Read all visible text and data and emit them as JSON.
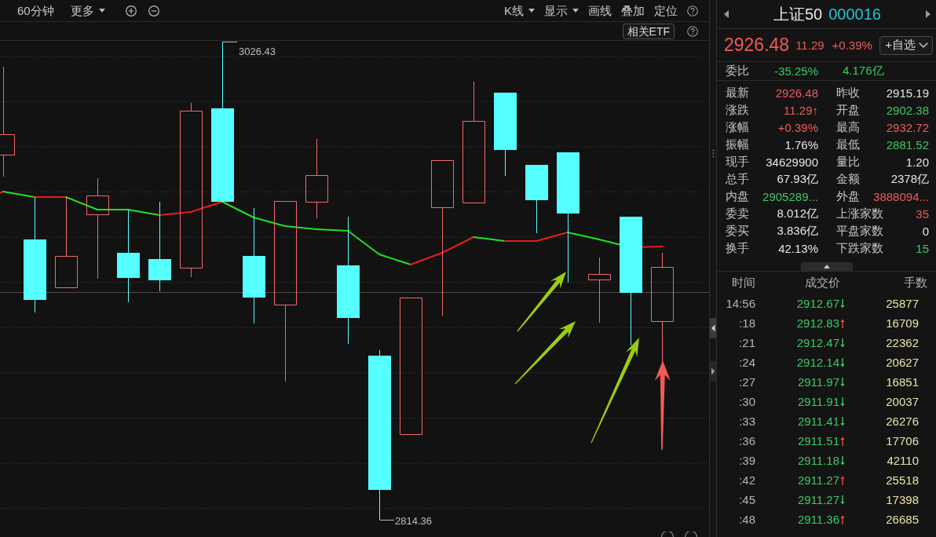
{
  "toolbar": {
    "left_items": [
      {
        "label": "60分钟",
        "dropdown": false
      },
      {
        "label": "更多",
        "dropdown": true
      }
    ],
    "right_items": [
      {
        "label": "K线",
        "dropdown": true
      },
      {
        "label": "显示",
        "dropdown": true
      },
      {
        "label": "画线",
        "dropdown": false
      },
      {
        "label": "叠加",
        "dropdown": false
      },
      {
        "label": "定位",
        "dropdown": false
      }
    ],
    "etf_button": "相关ETF"
  },
  "chart": {
    "high_label": "3026.43",
    "low_label": "2814.36"
  },
  "quote": {
    "name": "上证50",
    "code": "000016",
    "rising": true,
    "price": "2926.48",
    "change": "11.29",
    "change_pct": "+0.39%",
    "watch_button": "+自选",
    "order_ratio": {
      "label": "委比",
      "values": [
        {
          "text": "-35.25%",
          "color": "#3cc864"
        },
        {
          "text": "4.176亿",
          "color": "#3cc864"
        }
      ]
    },
    "fields": [
      {
        "label": "最新",
        "value": "2926.48",
        "color": "#f05a5a"
      },
      {
        "label": "昨收",
        "value": "2915.19",
        "color": "#e6e6e6"
      },
      {
        "label": "涨跌",
        "value": "11.29↑",
        "color": "#f05a5a"
      },
      {
        "label": "开盘",
        "value": "2902.38",
        "color": "#3cc864"
      },
      {
        "label": "涨幅",
        "value": "+0.39%",
        "color": "#f05a5a"
      },
      {
        "label": "最高",
        "value": "2932.72",
        "color": "#f05a5a"
      },
      {
        "label": "振幅",
        "value": "1.76%",
        "color": "#e6e6e6"
      },
      {
        "label": "最低",
        "value": "2881.52",
        "color": "#3cc864"
      },
      {
        "label": "现手",
        "value": "34629900",
        "color": "#e6e6e6"
      },
      {
        "label": "量比",
        "value": "1.20",
        "color": "#e6e6e6"
      },
      {
        "label": "总手",
        "value": "67.93亿",
        "color": "#e6e6e6"
      },
      {
        "label": "金额",
        "value": "2378亿",
        "color": "#e6e6e6"
      },
      {
        "label": "内盘",
        "value": "2905289...",
        "color": "#3cc864"
      },
      {
        "label": "外盘",
        "value": "3888094...",
        "color": "#f05a5a"
      },
      {
        "label": "委卖",
        "value": "8.012亿",
        "color": "#e6e6e6"
      },
      {
        "label": "上涨家数",
        "value": "35",
        "color": "#f05a5a"
      },
      {
        "label": "委买",
        "value": "3.836亿",
        "color": "#e6e6e6"
      },
      {
        "label": "平盘家数",
        "value": "0",
        "color": "#e6e6e6"
      },
      {
        "label": "换手",
        "value": "42.13%",
        "color": "#e6e6e6"
      },
      {
        "label": "下跌家数",
        "value": "15",
        "color": "#3cc864"
      }
    ]
  },
  "trades": {
    "columns": [
      "时间",
      "成交价",
      "手数"
    ],
    "rows": [
      {
        "time": "14:56",
        "price": "2912.67",
        "rising": false,
        "volume": "25877"
      },
      {
        "time": ":18",
        "price": "2912.83",
        "rising": true,
        "volume": "16709"
      },
      {
        "time": ":21",
        "price": "2912.47",
        "rising": false,
        "volume": "22362"
      },
      {
        "time": ":24",
        "price": "2912.14",
        "rising": false,
        "volume": "20627"
      },
      {
        "time": ":27",
        "price": "2911.97",
        "rising": false,
        "volume": "16851"
      },
      {
        "time": ":30",
        "price": "2911.91",
        "rising": false,
        "volume": "20037"
      },
      {
        "time": ":33",
        "price": "2911.41",
        "rising": false,
        "volume": "26276"
      },
      {
        "time": ":36",
        "price": "2911.51",
        "rising": true,
        "volume": "17706"
      },
      {
        "time": ":39",
        "price": "2911.18",
        "rising": false,
        "volume": "42110"
      },
      {
        "time": ":42",
        "price": "2911.27",
        "rising": true,
        "volume": "25518"
      },
      {
        "time": ":45",
        "price": "2911.27",
        "rising": false,
        "volume": "17398"
      },
      {
        "time": ":48",
        "price": "2911.36",
        "rising": true,
        "volume": "26685"
      }
    ]
  }
}
